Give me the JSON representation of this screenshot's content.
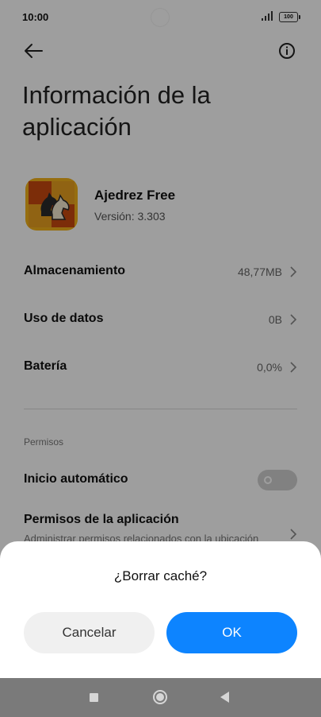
{
  "status_bar": {
    "time": "10:00",
    "battery": "100"
  },
  "header": {
    "title": "Información de la aplicación"
  },
  "app": {
    "name": "Ajedrez Free",
    "version": "Versión: 3.303"
  },
  "rows": [
    {
      "label": "Almacenamiento",
      "value": "48,77MB"
    },
    {
      "label": "Uso de datos",
      "value": "0B"
    },
    {
      "label": "Batería",
      "value": "0,0%"
    }
  ],
  "permissions": {
    "section_label": "Permisos",
    "autostart_label": "Inicio automático",
    "autostart_enabled": false,
    "app_permissions_title": "Permisos de la aplicación",
    "app_permissions_subtitle": "Administrar permisos relacionados con la ubicación"
  },
  "dialog": {
    "title": "¿Borrar caché?",
    "cancel_label": "Cancelar",
    "ok_label": "OK"
  },
  "colors": {
    "accent": "#0d84ff",
    "overlay": "rgba(0,0,0,0.38)",
    "nav_bar": "#7a7a7a"
  },
  "icons": {
    "back": "arrow-left-icon",
    "info": "info-circle-icon",
    "chevron": "chevron-right-icon",
    "app": "chess-knight-icon"
  }
}
